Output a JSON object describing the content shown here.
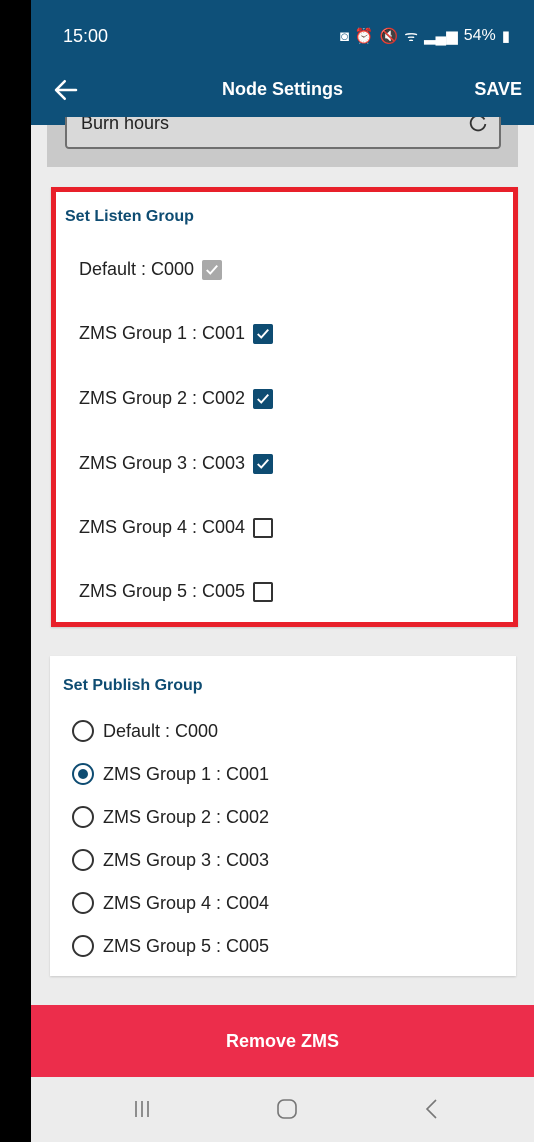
{
  "status": {
    "time": "15:00",
    "battery": "54%",
    "network": "LTE1"
  },
  "appbar": {
    "title": "Node Settings",
    "save_label": "SAVE"
  },
  "burn_field": {
    "label": "Burn hours"
  },
  "listen_group": {
    "title": "Set Listen Group",
    "items": [
      {
        "label": "Default : C000",
        "checked": true,
        "disabled": true
      },
      {
        "label": "ZMS Group 1 : C001",
        "checked": true,
        "disabled": false
      },
      {
        "label": "ZMS Group 2 : C002",
        "checked": true,
        "disabled": false
      },
      {
        "label": "ZMS Group 3 : C003",
        "checked": true,
        "disabled": false
      },
      {
        "label": "ZMS Group 4 : C004",
        "checked": false,
        "disabled": false
      },
      {
        "label": "ZMS Group 5 : C005",
        "checked": false,
        "disabled": false
      }
    ]
  },
  "publish_group": {
    "title": "Set Publish Group",
    "items": [
      {
        "label": "Default : C000",
        "selected": false
      },
      {
        "label": "ZMS Group 1 : C001",
        "selected": true
      },
      {
        "label": "ZMS Group 2 : C002",
        "selected": false
      },
      {
        "label": "ZMS Group 3 : C003",
        "selected": false
      },
      {
        "label": "ZMS Group 4 : C004",
        "selected": false
      },
      {
        "label": "ZMS Group 5 : C005",
        "selected": false
      }
    ]
  },
  "remove_button": {
    "label": "Remove ZMS"
  },
  "colors": {
    "primary": "#0e5079",
    "accent_text": "#0e4c72",
    "danger": "#ec2d4b",
    "highlight_border": "#e8202a"
  },
  "icons": {
    "back": "arrow-left-icon",
    "refresh": "refresh-icon",
    "nav_recents": "recents-icon",
    "nav_home": "home-icon",
    "nav_back": "chevron-left-icon"
  }
}
